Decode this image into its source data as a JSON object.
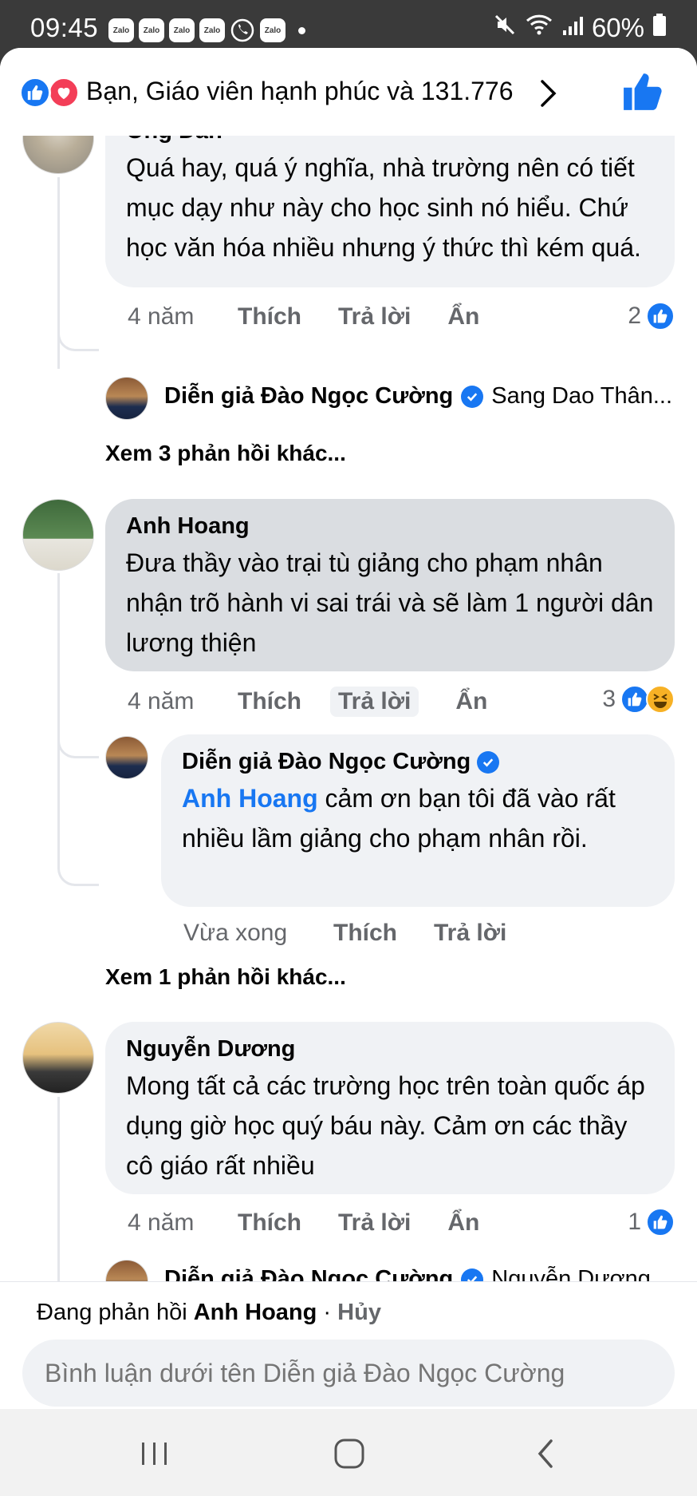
{
  "status_bar": {
    "time": "09:45",
    "notification_apps": [
      "Zalo",
      "Zalo",
      "Zalo",
      "Zalo",
      "phone",
      "Zalo"
    ],
    "battery": "60%"
  },
  "reactions_bar": {
    "summary": "Bạn, Giáo viên hạnh phúc và 131.776"
  },
  "comments": [
    {
      "author": "Ông Dân",
      "text": "Quá hay, quá ý nghĩa, nhà trường nên có tiết mục dạy như này cho học sinh nó hiểu. Chứ học văn hóa nhiều nhưng ý thức thì kém quá.",
      "time": "4 năm",
      "like_label": "Thích",
      "reply_label": "Trả lời",
      "hide_label": "Ẩn",
      "reaction_count": "2",
      "reply_preview": {
        "author": "Diễn giả Đào Ngọc Cường",
        "snippet": "Sang Dao Thân..."
      },
      "more_replies": "Xem 3 phản hồi khác..."
    },
    {
      "author": "Anh Hoang",
      "text": "Đưa thầy vào trại tù giảng cho phạm nhân nhận trõ hành vi sai trái và sẽ làm 1 người dân lương thiện",
      "time": "4 năm",
      "like_label": "Thích",
      "reply_label": "Trả lời",
      "hide_label": "Ẩn",
      "reaction_count": "3",
      "reply": {
        "author": "Diễn giả Đào Ngọc Cường",
        "mention": "Anh Hoang",
        "text": " cảm ơn bạn tôi đã vào rất nhiều lầm giảng cho phạm nhân rồi.",
        "time": "Vừa xong",
        "like_label": "Thích",
        "reply_label": "Trả lời"
      },
      "more_replies": "Xem 1 phản hồi khác..."
    },
    {
      "author": "Nguyễn Dương",
      "text": "Mong tất cả các trường học trên toàn quốc áp dụng giờ học quý báu này. Cảm ơn các thầy cô giáo rất nhiều",
      "time": "4 năm",
      "like_label": "Thích",
      "reply_label": "Trả lời",
      "hide_label": "Ẩn",
      "reaction_count": "1",
      "reply_preview": {
        "author": "Diễn giả Đào Ngọc Cường",
        "snippet": "Nguyễn Dương"
      }
    }
  ],
  "composer": {
    "replying_prefix": "Đang phản hồi ",
    "replying_to": "Anh Hoang",
    "separator": " · ",
    "cancel_label": "Hủy",
    "placeholder": "Bình luận dưới tên Diễn giả Đào Ngọc Cường"
  },
  "colors": {
    "accent": "#1877f2",
    "bubble": "#f0f2f5",
    "bubble_highlight": "#dadde1",
    "meta_text": "#65676b"
  }
}
